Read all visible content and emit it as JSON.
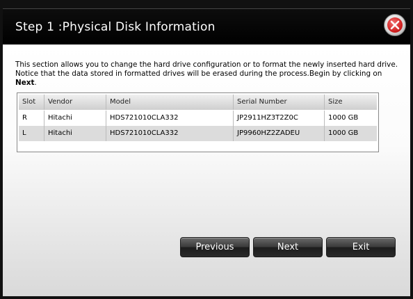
{
  "dialog": {
    "title": "Step 1 :Physical Disk Information",
    "close_icon": "close-x-icon"
  },
  "description": {
    "line1": "This section allows you to change the hard drive configuration or to format the newly inserted hard drive.",
    "line2_prefix": "Notice that the data stored in formatted drives will be erased during the process.Begin by clicking on ",
    "line2_bold": "Next",
    "line2_suffix": "."
  },
  "table": {
    "columns": [
      "Slot",
      "Vendor",
      "Model",
      "Serial Number",
      "Size"
    ],
    "rows": [
      [
        "R",
        "Hitachi",
        "HDS721010CLA332",
        "JP2911HZ3T2Z0C",
        "1000 GB"
      ],
      [
        "L",
        "Hitachi",
        "HDS721010CLA332",
        "JP9960HZ2ZADEU",
        "1000 GB"
      ]
    ]
  },
  "buttons": {
    "previous": "Previous",
    "next": "Next",
    "exit": "Exit"
  },
  "colors": {
    "accent_close": "#d62a2a",
    "header_bg": "#000000",
    "button_bg": "#2a2a2a"
  }
}
